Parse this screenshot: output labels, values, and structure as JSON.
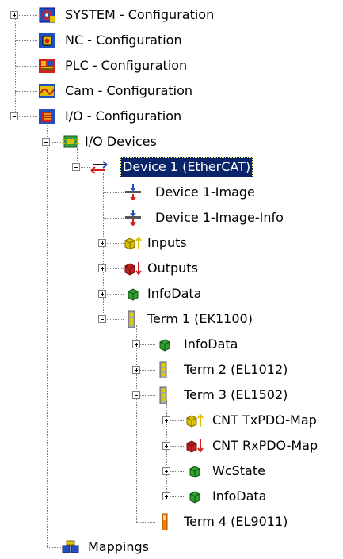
{
  "selected_id": "device1",
  "colors": {
    "selection_bg": "#0a246a",
    "selection_fg": "#ffffff"
  },
  "nodes": [
    {
      "id": "system",
      "label": "SYSTEM - Configuration",
      "icon": "system-config-icon",
      "toggle": "plus"
    },
    {
      "id": "nc",
      "label": "NC - Configuration",
      "icon": "nc-config-icon",
      "toggle": null
    },
    {
      "id": "plc",
      "label": "PLC - Configuration",
      "icon": "plc-config-icon",
      "toggle": null
    },
    {
      "id": "cam",
      "label": "Cam - Configuration",
      "icon": "cam-config-icon",
      "toggle": null
    },
    {
      "id": "io",
      "label": "I/O - Configuration",
      "icon": "io-config-icon",
      "toggle": "minus"
    },
    {
      "id": "iodev",
      "label": "I/O Devices",
      "icon": "io-devices-icon",
      "toggle": "minus"
    },
    {
      "id": "device1",
      "label": "Device 1 (EtherCAT)",
      "icon": "ethercat-device-icon",
      "toggle": "minus"
    },
    {
      "id": "img",
      "label": "Device 1-Image",
      "icon": "process-image-icon",
      "toggle": null
    },
    {
      "id": "imginfo",
      "label": "Device 1-Image-Info",
      "icon": "process-image-icon",
      "toggle": null
    },
    {
      "id": "inputs",
      "label": "Inputs",
      "icon": "inputs-icon",
      "toggle": "plus"
    },
    {
      "id": "outputs",
      "label": "Outputs",
      "icon": "outputs-icon",
      "toggle": "plus"
    },
    {
      "id": "infod1",
      "label": "InfoData",
      "icon": "infodata-icon",
      "toggle": "plus"
    },
    {
      "id": "term1",
      "label": "Term 1 (EK1100)",
      "icon": "terminal-icon",
      "toggle": "minus"
    },
    {
      "id": "infot1",
      "label": "InfoData",
      "icon": "infodata-icon",
      "toggle": "plus"
    },
    {
      "id": "term2",
      "label": "Term 2 (EL1012)",
      "icon": "terminal-icon",
      "toggle": "plus"
    },
    {
      "id": "term3",
      "label": "Term 3 (EL1502)",
      "icon": "terminal-icon",
      "toggle": "minus"
    },
    {
      "id": "cnttx",
      "label": "CNT TxPDO-Map",
      "icon": "inputs-icon",
      "toggle": "plus"
    },
    {
      "id": "cntrx",
      "label": "CNT RxPDO-Map",
      "icon": "outputs-icon",
      "toggle": "plus"
    },
    {
      "id": "wcstate",
      "label": "WcState",
      "icon": "infodata-icon",
      "toggle": "plus"
    },
    {
      "id": "infot3",
      "label": "InfoData",
      "icon": "infodata-icon",
      "toggle": "plus"
    },
    {
      "id": "term4",
      "label": "Term 4 (EL9011)",
      "icon": "end-terminal-icon",
      "toggle": null
    },
    {
      "id": "mappings",
      "label": "Mappings",
      "icon": "mappings-icon",
      "toggle": null
    }
  ]
}
